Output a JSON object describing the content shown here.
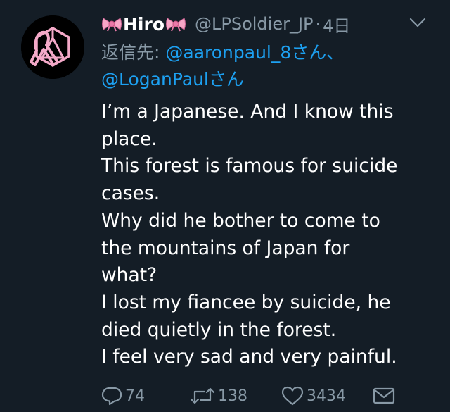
{
  "colors": {
    "background": "#141d26",
    "primary_text": "#ffffff",
    "secondary_text": "#8899a6",
    "link": "#1da1f2",
    "avatar_accent": "#f4a9c8"
  },
  "tweet": {
    "display_name": "Hiro",
    "display_name_decorations": [
      "ribbon-bow-icon",
      "ribbon-bow-icon"
    ],
    "handle": "@LPSoldier_JP",
    "separator": "·",
    "time": "4日",
    "reply_prefix": "返信先: ",
    "reply_mentions": [
      "@aaronpaul_8さん、",
      "@LoganPaulさん"
    ],
    "body_lines": [
      "I’m a Japanese. And I know this",
      "place.",
      "This forest is famous for suicide",
      "cases.",
      "Why did he bother to come to",
      "the mountains of Japan for",
      "what?",
      "I lost my fiancee by suicide, he",
      "died quietly in the forest.",
      "I feel very sad and very painful."
    ],
    "actions": {
      "reply_count": "74",
      "retweet_count": "138",
      "like_count": "3434"
    }
  }
}
